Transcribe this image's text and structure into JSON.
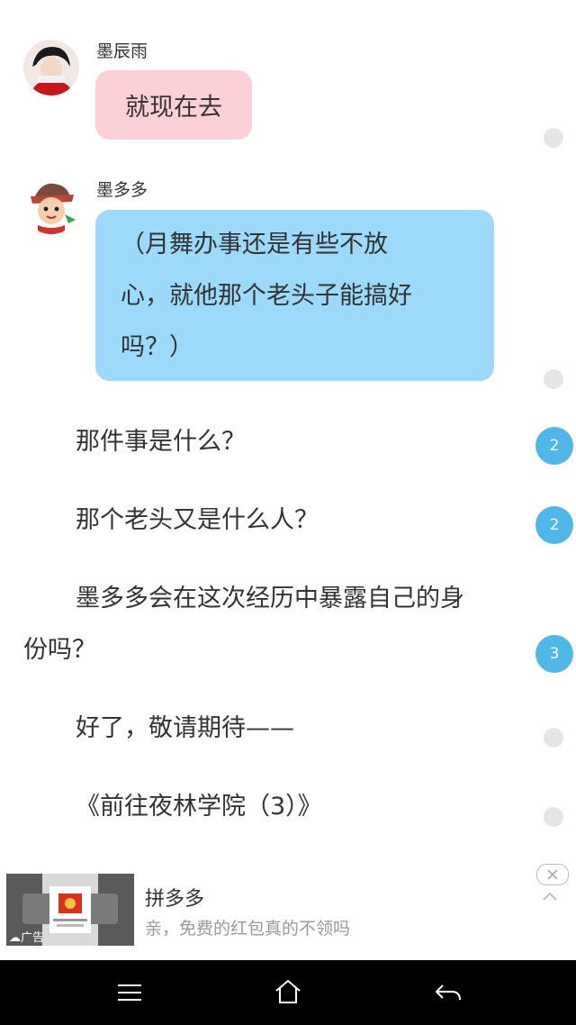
{
  "messages": [
    {
      "sender": "墨辰雨",
      "text": "就现在去"
    },
    {
      "sender": "墨多多",
      "lines": [
        "（月舞办事还是有些不放",
        "心，就他那个老头子能搞好",
        "吗？）"
      ]
    }
  ],
  "paragraphs": [
    {
      "text": "那件事是什么？",
      "badge": "2"
    },
    {
      "text": "那个老头又是什么人？",
      "badge": "2"
    },
    {
      "line1": "墨多多会在这次经历中暴露自己的身",
      "line2": "份吗？",
      "badge": "3"
    },
    {
      "text": "好了，敬请期待——"
    },
    {
      "text": "《前往夜林学院（3）》"
    }
  ],
  "ad": {
    "title": "拼多多",
    "subtitle": "亲，免费的红包真的不领吗",
    "tag": "广告"
  },
  "navbar": {
    "icons": [
      "menu-icon",
      "home-icon",
      "back-icon"
    ]
  }
}
